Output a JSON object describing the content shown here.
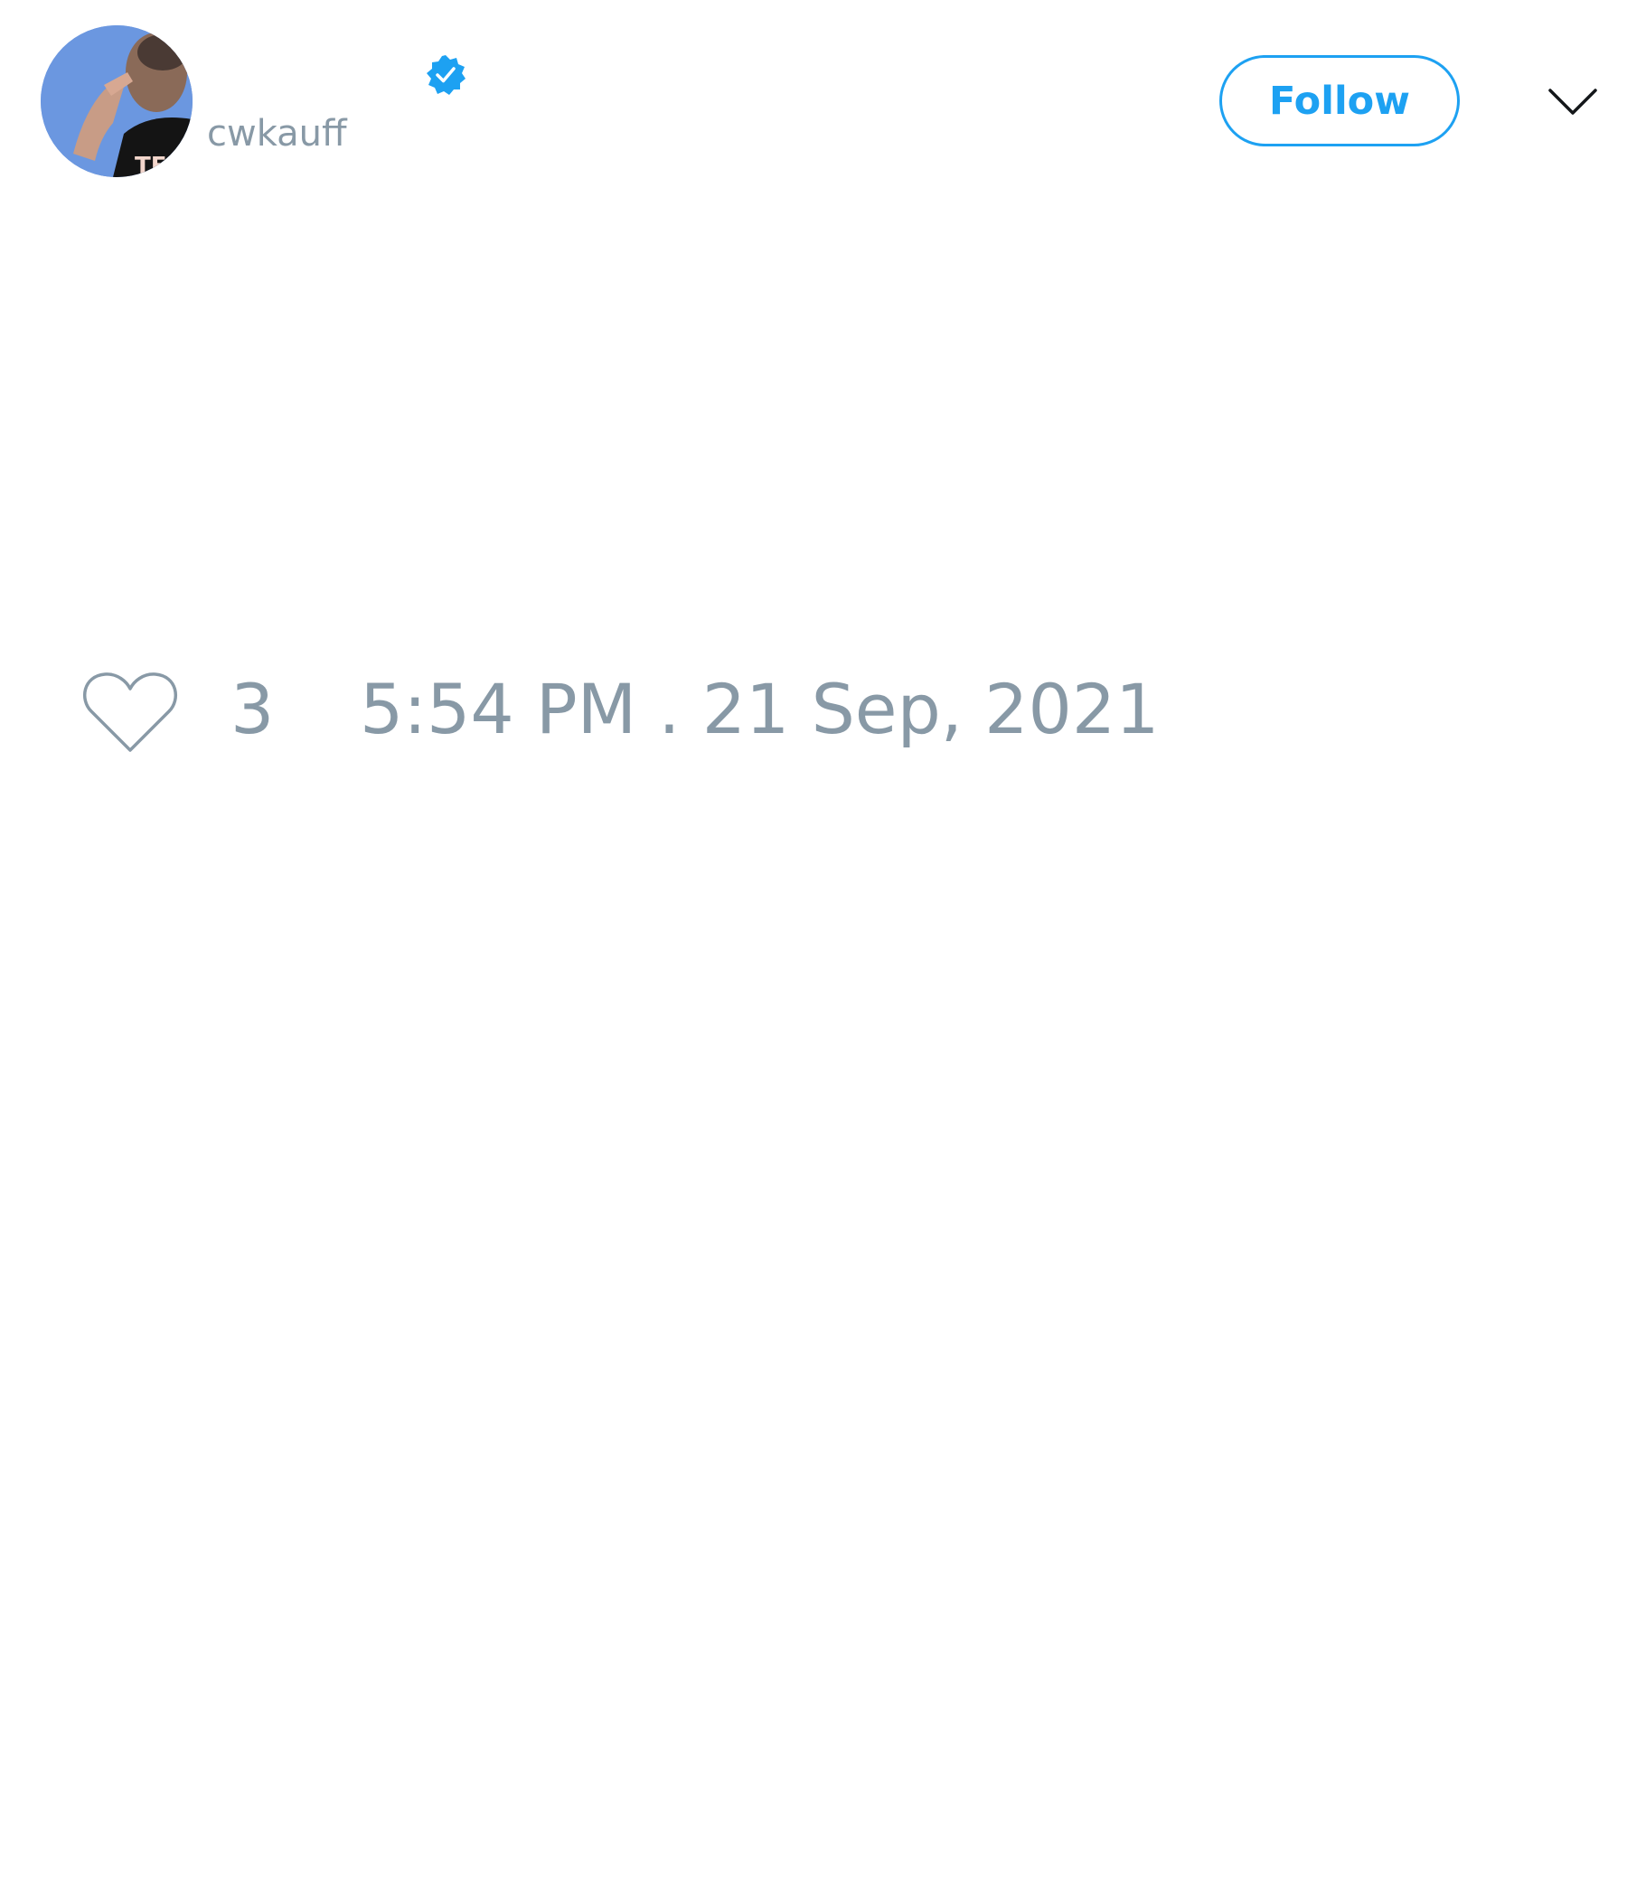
{
  "author": {
    "display_name": "",
    "handle": "cwkauff",
    "verified": true
  },
  "header": {
    "follow_label": "Follow"
  },
  "tweet": {
    "like_count": "3",
    "timestamp": "5:54 PM . 21 Sep, 2021"
  },
  "icons": {
    "verified": "verified-badge-icon",
    "menu": "chevron-down-icon",
    "like": "heart-icon"
  },
  "colors": {
    "accent": "#1da1f2",
    "muted_text": "#8899a6",
    "background": "#ffffff"
  }
}
